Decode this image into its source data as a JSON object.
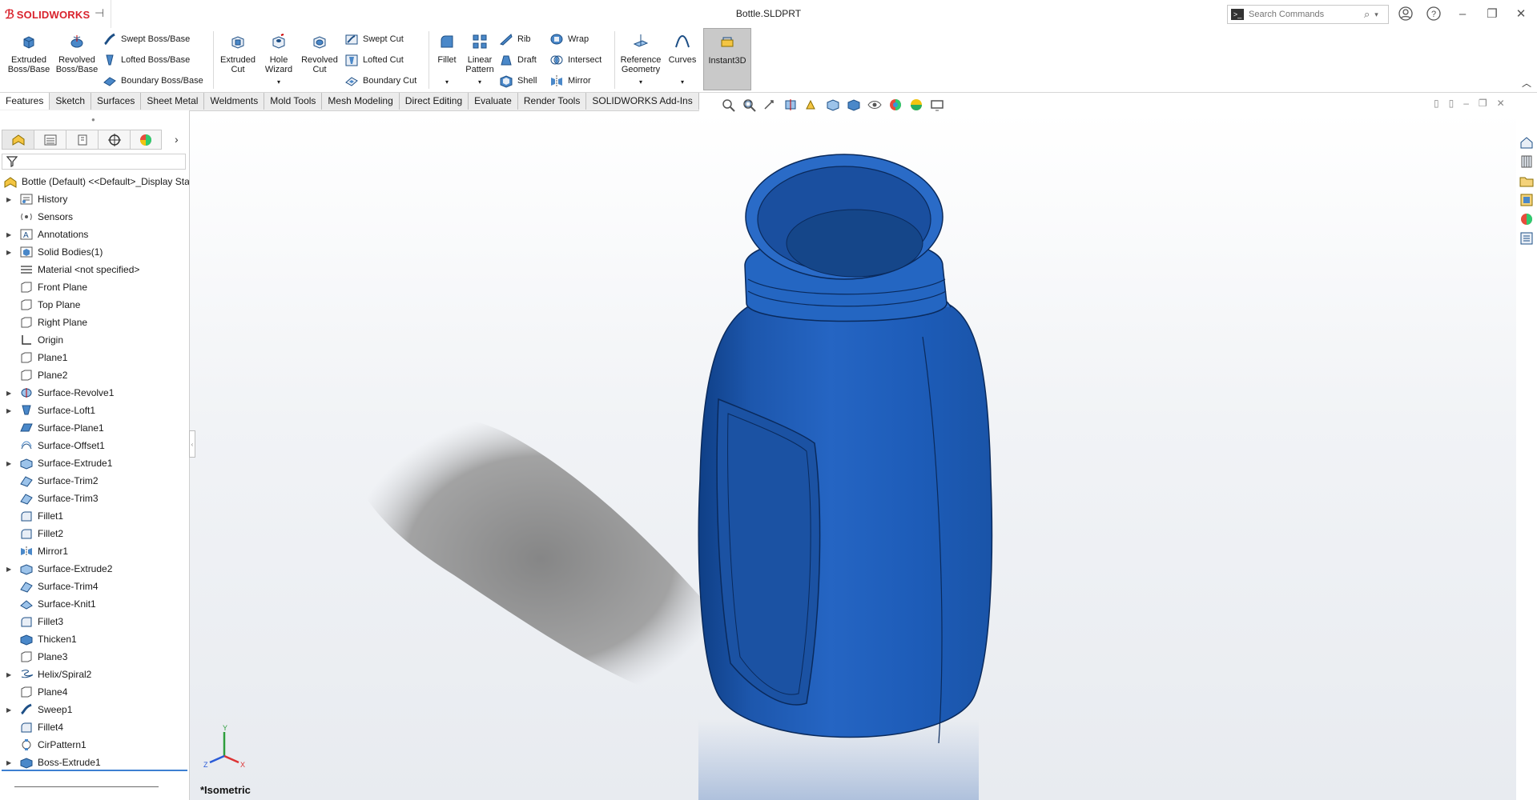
{
  "app": {
    "brand": "SOLIDWORKS",
    "document_title": "Bottle.SLDPRT",
    "search_placeholder": "Search Commands"
  },
  "ribbon": {
    "extruded_boss": "Extruded\nBoss/Base",
    "revolved_boss": "Revolved\nBoss/Base",
    "swept_boss": "Swept Boss/Base",
    "lofted_boss": "Lofted Boss/Base",
    "boundary_boss": "Boundary Boss/Base",
    "extruded_cut": "Extruded\nCut",
    "hole_wizard": "Hole\nWizard",
    "revolved_cut": "Revolved\nCut",
    "swept_cut": "Swept Cut",
    "lofted_cut": "Lofted Cut",
    "boundary_cut": "Boundary Cut",
    "fillet": "Fillet",
    "linear_pattern": "Linear\nPattern",
    "rib": "Rib",
    "draft": "Draft",
    "shell": "Shell",
    "wrap": "Wrap",
    "intersect": "Intersect",
    "mirror": "Mirror",
    "reference_geometry": "Reference\nGeometry",
    "curves": "Curves",
    "instant3d": "Instant3D"
  },
  "tabs": [
    "Features",
    "Sketch",
    "Surfaces",
    "Sheet Metal",
    "Weldments",
    "Mold Tools",
    "Mesh Modeling",
    "Direct Editing",
    "Evaluate",
    "Render Tools",
    "SOLIDWORKS Add-Ins"
  ],
  "active_tab": "Features",
  "tree": {
    "root": "Bottle (Default) <<Default>_Display Sta",
    "items": [
      {
        "label": "History",
        "icon": "history-icon",
        "expandable": true
      },
      {
        "label": "Sensors",
        "icon": "sensors-icon",
        "expandable": false
      },
      {
        "label": "Annotations",
        "icon": "annotations-icon",
        "expandable": true
      },
      {
        "label": "Solid Bodies(1)",
        "icon": "solid-bodies-icon",
        "expandable": true
      },
      {
        "label": "Material <not specified>",
        "icon": "material-icon",
        "expandable": false
      },
      {
        "label": "Front Plane",
        "icon": "plane-icon",
        "expandable": false
      },
      {
        "label": "Top Plane",
        "icon": "plane-icon",
        "expandable": false
      },
      {
        "label": "Right Plane",
        "icon": "plane-icon",
        "expandable": false
      },
      {
        "label": "Origin",
        "icon": "origin-icon",
        "expandable": false
      },
      {
        "label": "Plane1",
        "icon": "plane-icon",
        "expandable": false
      },
      {
        "label": "Plane2",
        "icon": "plane-icon",
        "expandable": false
      },
      {
        "label": "Surface-Revolve1",
        "icon": "surface-revolve-icon",
        "expandable": true
      },
      {
        "label": "Surface-Loft1",
        "icon": "surface-loft-icon",
        "expandable": true
      },
      {
        "label": "Surface-Plane1",
        "icon": "surface-plane-icon",
        "expandable": false
      },
      {
        "label": "Surface-Offset1",
        "icon": "surface-offset-icon",
        "expandable": false
      },
      {
        "label": "Surface-Extrude1",
        "icon": "surface-extrude-icon",
        "expandable": true
      },
      {
        "label": "Surface-Trim2",
        "icon": "surface-trim-icon",
        "expandable": false
      },
      {
        "label": "Surface-Trim3",
        "icon": "surface-trim-icon",
        "expandable": false
      },
      {
        "label": "Fillet1",
        "icon": "fillet-icon",
        "expandable": false
      },
      {
        "label": "Fillet2",
        "icon": "fillet-icon",
        "expandable": false
      },
      {
        "label": "Mirror1",
        "icon": "mirror-icon",
        "expandable": false
      },
      {
        "label": "Surface-Extrude2",
        "icon": "surface-extrude-icon",
        "expandable": true
      },
      {
        "label": "Surface-Trim4",
        "icon": "surface-trim-icon",
        "expandable": false
      },
      {
        "label": "Surface-Knit1",
        "icon": "surface-knit-icon",
        "expandable": false
      },
      {
        "label": "Fillet3",
        "icon": "fillet-icon",
        "expandable": false
      },
      {
        "label": "Thicken1",
        "icon": "thicken-icon",
        "expandable": false
      },
      {
        "label": "Plane3",
        "icon": "plane-icon",
        "expandable": false
      },
      {
        "label": "Helix/Spiral2",
        "icon": "helix-icon",
        "expandable": true
      },
      {
        "label": "Plane4",
        "icon": "plane-icon",
        "expandable": false
      },
      {
        "label": "Sweep1",
        "icon": "sweep-icon",
        "expandable": true
      },
      {
        "label": "Fillet4",
        "icon": "fillet-icon",
        "expandable": false
      },
      {
        "label": "CirPattern1",
        "icon": "circular-pattern-icon",
        "expandable": false
      },
      {
        "label": "Boss-Extrude1",
        "icon": "boss-extrude-icon",
        "expandable": true
      }
    ]
  },
  "viewport": {
    "view_name": "*Isometric",
    "model_color": "#1f5fb8",
    "triad_labels": {
      "x": "X",
      "y": "Y",
      "z": "Z"
    }
  },
  "colors": {
    "brand_red": "#d9232d",
    "active_tab_bg": "#ffffff",
    "selection_blue": "#3c7fd1"
  }
}
